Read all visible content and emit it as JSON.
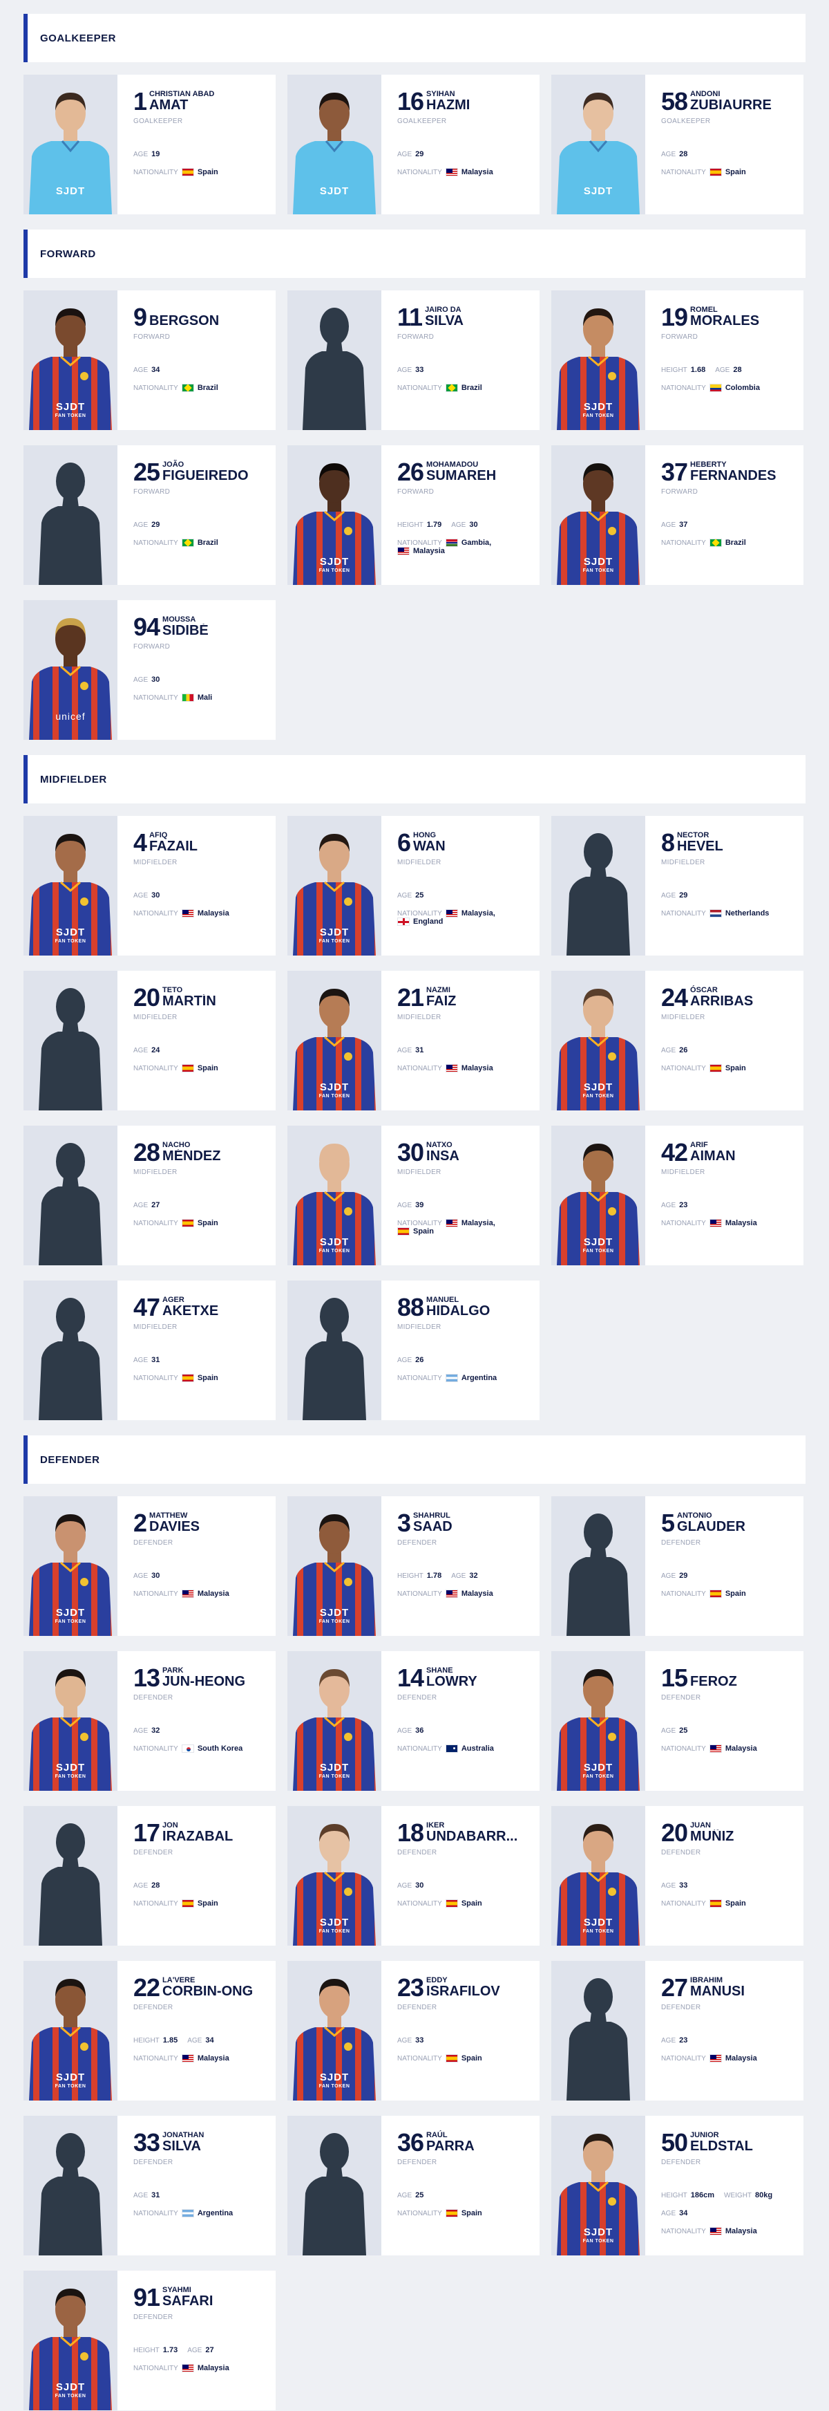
{
  "sections": [
    {
      "title": "GOALKEEPER",
      "players": [
        {
          "number": "1",
          "first": "CHRISTIAN ABAD",
          "last": "AMAT",
          "position": "GOALKEEPER",
          "age": "19",
          "height": "",
          "weight": "",
          "nationality": [
            {
              "name": "Spain",
              "flag": "spain"
            }
          ],
          "photo": "gk-kit",
          "skin": "#e3b996",
          "hair": "#3b2a20"
        },
        {
          "number": "16",
          "first": "SYIHAN",
          "last": "HAZMI",
          "position": "GOALKEEPER",
          "age": "29",
          "height": "",
          "weight": "",
          "nationality": [
            {
              "name": "Malaysia",
              "flag": "malaysia"
            }
          ],
          "photo": "gk-kit",
          "skin": "#8d5a3b",
          "hair": "#1d1410"
        },
        {
          "number": "58",
          "first": "ANDONI",
          "last": "ZUBIAURRE",
          "position": "GOALKEEPER",
          "age": "28",
          "height": "",
          "weight": "",
          "nationality": [
            {
              "name": "Spain",
              "flag": "spain"
            }
          ],
          "photo": "gk-kit",
          "skin": "#e6c0a0",
          "hair": "#3e2c22"
        }
      ]
    },
    {
      "title": "FORWARD",
      "players": [
        {
          "number": "9",
          "first": "",
          "last": "BERGSON",
          "position": "FORWARD",
          "age": "34",
          "height": "",
          "weight": "",
          "nationality": [
            {
              "name": "Brazil",
              "flag": "brazil"
            }
          ],
          "photo": "home-kit",
          "skin": "#7a4a2e",
          "hair": "#1a1210"
        },
        {
          "number": "11",
          "first": "JAIRO DA",
          "last": "SILVA",
          "position": "FORWARD",
          "age": "33",
          "height": "",
          "weight": "",
          "nationality": [
            {
              "name": "Brazil",
              "flag": "brazil"
            }
          ],
          "photo": "silhouette",
          "skin": "",
          "hair": ""
        },
        {
          "number": "19",
          "first": "ROMEL",
          "last": "MORALES",
          "position": "FORWARD",
          "age": "28",
          "height": "1.68",
          "weight": "",
          "nationality": [
            {
              "name": "Colombia",
              "flag": "colombia"
            }
          ],
          "photo": "home-kit",
          "skin": "#c58c63",
          "hair": "#231711"
        },
        {
          "number": "25",
          "first": "JOÃO",
          "last": "FIGUEIREDO",
          "position": "FORWARD",
          "age": "29",
          "height": "",
          "weight": "",
          "nationality": [
            {
              "name": "Brazil",
              "flag": "brazil"
            }
          ],
          "photo": "silhouette",
          "skin": "",
          "hair": ""
        },
        {
          "number": "26",
          "first": "MOHAMADOU",
          "last": "SUMAREH",
          "position": "FORWARD",
          "age": "30",
          "height": "1.79",
          "weight": "",
          "nationality": [
            {
              "name": "Gambia,",
              "flag": "gambia"
            },
            {
              "name": "Malaysia",
              "flag": "malaysia"
            }
          ],
          "photo": "home-kit",
          "skin": "#4e2f1f",
          "hair": "#0e0907"
        },
        {
          "number": "37",
          "first": "HEBERTY",
          "last": "FERNANDES",
          "position": "FORWARD",
          "age": "37",
          "height": "",
          "weight": "",
          "nationality": [
            {
              "name": "Brazil",
              "flag": "brazil"
            }
          ],
          "photo": "home-kit",
          "skin": "#5e3824",
          "hair": "#14100d"
        },
        {
          "number": "94",
          "first": "MOUSSA",
          "last": "SIDIBÉ",
          "position": "FORWARD",
          "age": "30",
          "height": "",
          "weight": "",
          "nationality": [
            {
              "name": "Mali",
              "flag": "mali"
            }
          ],
          "photo": "unicef-kit",
          "skin": "#5a3520",
          "hair": "#c9a24a"
        }
      ]
    },
    {
      "title": "MIDFIELDER",
      "players": [
        {
          "number": "4",
          "first": "AFIQ",
          "last": "FAZAIL",
          "position": "MIDFIELDER",
          "age": "30",
          "height": "",
          "weight": "",
          "nationality": [
            {
              "name": "Malaysia",
              "flag": "malaysia"
            }
          ],
          "photo": "home-kit",
          "skin": "#a46c49",
          "hair": "#1b1411"
        },
        {
          "number": "6",
          "first": "HONG",
          "last": "WAN",
          "position": "MIDFIELDER",
          "age": "25",
          "height": "",
          "weight": "",
          "nationality": [
            {
              "name": "Malaysia,",
              "flag": "malaysia"
            },
            {
              "name": "England",
              "flag": "england"
            }
          ],
          "photo": "home-kit",
          "skin": "#d9a986",
          "hair": "#241913"
        },
        {
          "number": "8",
          "first": "NECTOR",
          "last": "HEVEL",
          "position": "MIDFIELDER",
          "age": "29",
          "height": "",
          "weight": "",
          "nationality": [
            {
              "name": "Netherlands",
              "flag": "netherlands"
            }
          ],
          "photo": "silhouette",
          "skin": "",
          "hair": ""
        },
        {
          "number": "20",
          "first": "TETO",
          "last": "MARTÍN",
          "position": "MIDFIELDER",
          "age": "24",
          "height": "",
          "weight": "",
          "nationality": [
            {
              "name": "Spain",
              "flag": "spain"
            }
          ],
          "photo": "silhouette",
          "skin": "",
          "hair": ""
        },
        {
          "number": "21",
          "first": "NAZMI",
          "last": "FAIZ",
          "position": "MIDFIELDER",
          "age": "31",
          "height": "",
          "weight": "",
          "nationality": [
            {
              "name": "Malaysia",
              "flag": "malaysia"
            }
          ],
          "photo": "home-kit",
          "skin": "#b67c55",
          "hair": "#1b1411"
        },
        {
          "number": "24",
          "first": "ÓSCAR",
          "last": "ARRIBAS",
          "position": "MIDFIELDER",
          "age": "26",
          "height": "",
          "weight": "",
          "nationality": [
            {
              "name": "Spain",
              "flag": "spain"
            }
          ],
          "photo": "home-kit",
          "skin": "#e0b491",
          "hair": "#5a3f2c"
        },
        {
          "number": "28",
          "first": "NACHO",
          "last": "MÉNDEZ",
          "position": "MIDFIELDER",
          "age": "27",
          "height": "",
          "weight": "",
          "nationality": [
            {
              "name": "Spain",
              "flag": "spain"
            }
          ],
          "photo": "silhouette",
          "skin": "",
          "hair": ""
        },
        {
          "number": "30",
          "first": "NATXO",
          "last": "INSA",
          "position": "MIDFIELDER",
          "age": "39",
          "height": "",
          "weight": "",
          "nationality": [
            {
              "name": "Malaysia,",
              "flag": "malaysia"
            },
            {
              "name": "Spain",
              "flag": "spain"
            }
          ],
          "photo": "home-kit",
          "skin": "#e2b897",
          "hair": "#e2b897"
        },
        {
          "number": "42",
          "first": "ARIF",
          "last": "AIMAN",
          "position": "MIDFIELDER",
          "age": "23",
          "height": "",
          "weight": "",
          "nationality": [
            {
              "name": "Malaysia",
              "flag": "malaysia"
            }
          ],
          "photo": "home-kit",
          "skin": "#a77048",
          "hair": "#1b1411"
        },
        {
          "number": "47",
          "first": "AGER",
          "last": "AKETXE",
          "position": "MIDFIELDER",
          "age": "31",
          "height": "",
          "weight": "",
          "nationality": [
            {
              "name": "Spain",
              "flag": "spain"
            }
          ],
          "photo": "silhouette",
          "skin": "",
          "hair": ""
        },
        {
          "number": "88",
          "first": "MANUEL",
          "last": "HIDALGO",
          "position": "MIDFIELDER",
          "age": "26",
          "height": "",
          "weight": "",
          "nationality": [
            {
              "name": "Argentina",
              "flag": "argentina"
            }
          ],
          "photo": "silhouette",
          "skin": "",
          "hair": ""
        }
      ]
    },
    {
      "title": "DEFENDER",
      "players": [
        {
          "number": "2",
          "first": "MATTHEW",
          "last": "DAVIES",
          "position": "DEFENDER",
          "age": "30",
          "height": "",
          "weight": "",
          "nationality": [
            {
              "name": "Malaysia",
              "flag": "malaysia"
            }
          ],
          "photo": "home-kit",
          "skin": "#c99270",
          "hair": "#1b1411"
        },
        {
          "number": "3",
          "first": "SHAHRUL",
          "last": "SAAD",
          "position": "DEFENDER",
          "age": "32",
          "height": "1.78",
          "weight": "",
          "nationality": [
            {
              "name": "Malaysia",
              "flag": "malaysia"
            }
          ],
          "photo": "home-kit",
          "skin": "#8f5b3b",
          "hair": "#1b1411"
        },
        {
          "number": "5",
          "first": "ANTONIO",
          "last": "GLAUDER",
          "position": "DEFENDER",
          "age": "29",
          "height": "",
          "weight": "",
          "nationality": [
            {
              "name": "Spain",
              "flag": "spain"
            }
          ],
          "photo": "silhouette",
          "skin": "",
          "hair": ""
        },
        {
          "number": "13",
          "first": "PARK",
          "last": "JUN-HEONG",
          "position": "DEFENDER",
          "age": "32",
          "height": "",
          "weight": "",
          "nationality": [
            {
              "name": "South Korea",
              "flag": "southkorea"
            }
          ],
          "photo": "home-kit",
          "skin": "#e0b692",
          "hair": "#1b1411"
        },
        {
          "number": "14",
          "first": "SHANE",
          "last": "LOWRY",
          "position": "DEFENDER",
          "age": "36",
          "height": "",
          "weight": "",
          "nationality": [
            {
              "name": "Australia",
              "flag": "australia"
            }
          ],
          "photo": "home-kit",
          "skin": "#e4b99a",
          "hair": "#6b4a32"
        },
        {
          "number": "15",
          "first": "",
          "last": "FEROZ",
          "position": "DEFENDER",
          "age": "25",
          "height": "",
          "weight": "",
          "nationality": [
            {
              "name": "Malaysia",
              "flag": "malaysia"
            }
          ],
          "photo": "home-kit",
          "skin": "#b57a52",
          "hair": "#1b1411"
        },
        {
          "number": "17",
          "first": "JON",
          "last": "IRAZABAL",
          "position": "DEFENDER",
          "age": "28",
          "height": "",
          "weight": "",
          "nationality": [
            {
              "name": "Spain",
              "flag": "spain"
            }
          ],
          "photo": "silhouette",
          "skin": "",
          "hair": ""
        },
        {
          "number": "18",
          "first": "IKER",
          "last": "UNDABARR...",
          "position": "DEFENDER",
          "age": "30",
          "height": "",
          "weight": "",
          "nationality": [
            {
              "name": "Spain",
              "flag": "spain"
            }
          ],
          "photo": "home-kit",
          "skin": "#e6c2a4",
          "hair": "#5c3e2a"
        },
        {
          "number": "20",
          "first": "JUAN",
          "last": "MUÑIZ",
          "position": "DEFENDER",
          "age": "33",
          "height": "",
          "weight": "",
          "nationality": [
            {
              "name": "Spain",
              "flag": "spain"
            }
          ],
          "photo": "home-kit",
          "skin": "#d9a783",
          "hair": "#2a1d15"
        },
        {
          "number": "22",
          "first": "LA'VERE",
          "last": "CORBIN-ONG",
          "position": "DEFENDER",
          "age": "34",
          "height": "1.85",
          "weight": "",
          "nationality": [
            {
              "name": "Malaysia",
              "flag": "malaysia"
            }
          ],
          "photo": "home-kit",
          "skin": "#8a5636",
          "hair": "#1b1411"
        },
        {
          "number": "23",
          "first": "EDDY",
          "last": "ISRAFILOV",
          "position": "DEFENDER",
          "age": "33",
          "height": "",
          "weight": "",
          "nationality": [
            {
              "name": "Spain",
              "flag": "spain"
            }
          ],
          "photo": "home-kit",
          "skin": "#d7a27e",
          "hair": "#1b1411"
        },
        {
          "number": "27",
          "first": "IBRAHIM",
          "last": "MANUSI",
          "position": "DEFENDER",
          "age": "23",
          "height": "",
          "weight": "",
          "nationality": [
            {
              "name": "Malaysia",
              "flag": "malaysia"
            }
          ],
          "photo": "silhouette",
          "skin": "",
          "hair": ""
        },
        {
          "number": "33",
          "first": "JONATHAN",
          "last": "SILVA",
          "position": "DEFENDER",
          "age": "31",
          "height": "",
          "weight": "",
          "nationality": [
            {
              "name": "Argentina",
              "flag": "argentina"
            }
          ],
          "photo": "silhouette",
          "skin": "",
          "hair": ""
        },
        {
          "number": "36",
          "first": "RAÚL",
          "last": "PARRA",
          "position": "DEFENDER",
          "age": "25",
          "height": "",
          "weight": "",
          "nationality": [
            {
              "name": "Spain",
              "flag": "spain"
            }
          ],
          "photo": "silhouette",
          "skin": "",
          "hair": ""
        },
        {
          "number": "50",
          "first": "JUNIOR",
          "last": "ELDSTAL",
          "position": "DEFENDER",
          "age": "34",
          "height": "186cm",
          "weight": "80kg",
          "nationality": [
            {
              "name": "Malaysia",
              "flag": "malaysia"
            }
          ],
          "photo": "home-kit",
          "skin": "#d9a985",
          "hair": "#2a1d15"
        },
        {
          "number": "91",
          "first": "SYAHMI",
          "last": "SAFARI",
          "position": "DEFENDER",
          "age": "27",
          "height": "1.73",
          "weight": "",
          "nationality": [
            {
              "name": "Malaysia",
              "flag": "malaysia"
            }
          ],
          "photo": "home-kit",
          "skin": "#9b6443",
          "hair": "#1b1411"
        }
      ]
    }
  ],
  "labels": {
    "age": "AGE",
    "height": "HEIGHT",
    "weight": "WEIGHT",
    "nationality": "NATIONALITY",
    "kit_brand": "SJDT",
    "kit_sponsor": "FAN TOKEN",
    "unicef_sponsor": "unicef"
  },
  "colors": {
    "navy": "#0f1a44",
    "accent": "#1e3aa8",
    "kit_blue": "#2a3f9e",
    "kit_red": "#d8402c",
    "gk_kit": "#5ec1ea",
    "silhouette": "#2e3a48"
  }
}
